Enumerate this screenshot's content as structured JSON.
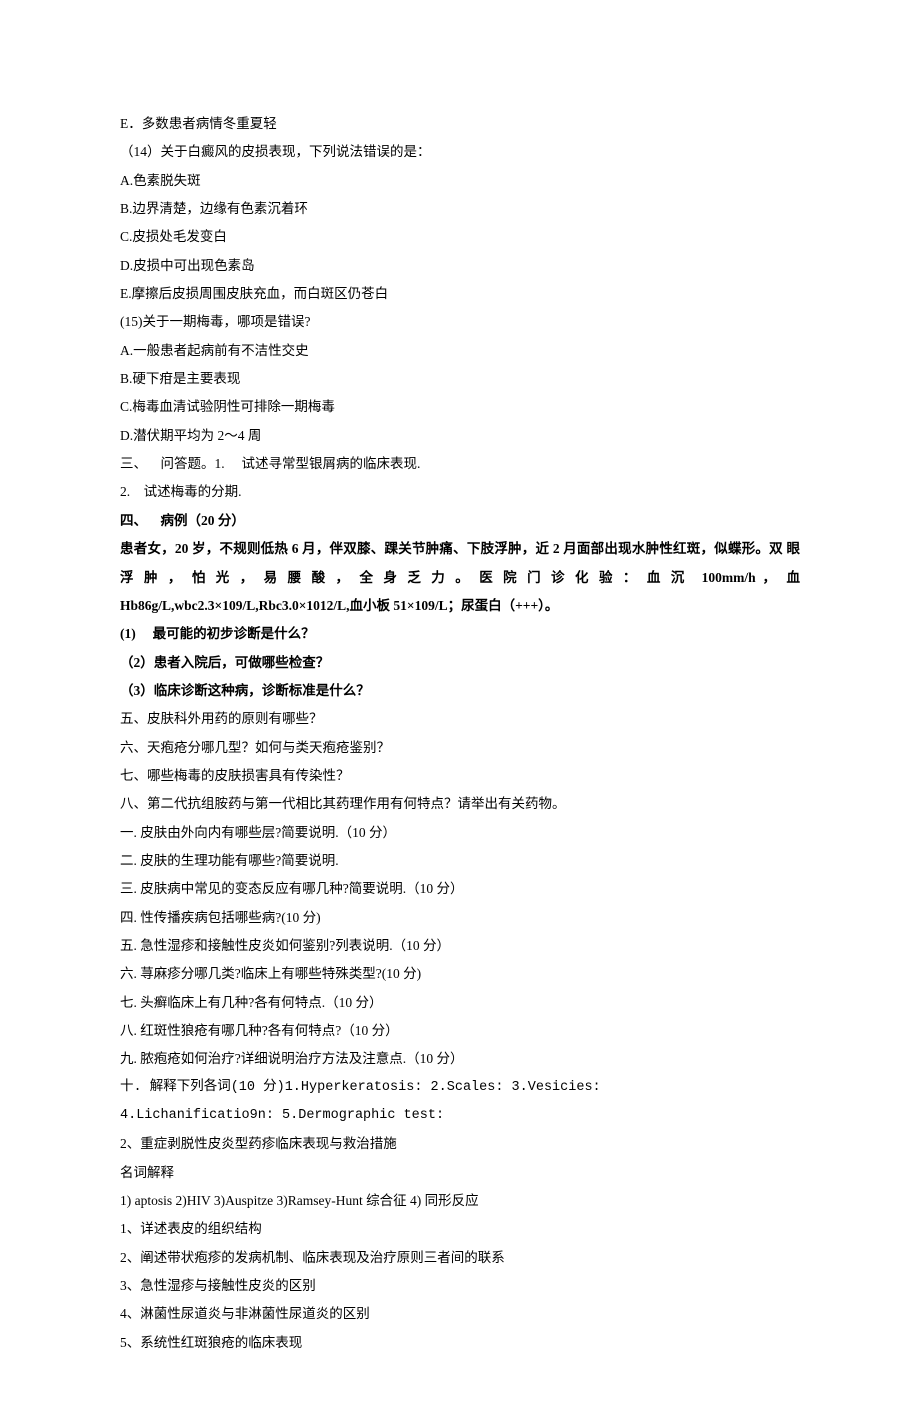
{
  "lines": [
    {
      "text": "E．多数患者病情冬重夏轻",
      "bold": false
    },
    {
      "text": "（14）关于白癜风的皮损表现，下列说法错误的是：",
      "bold": false
    },
    {
      "text": "A.色素脱失斑",
      "bold": false
    },
    {
      "text": "B.边界清楚，边缘有色素沉着环",
      "bold": false
    },
    {
      "text": "C.皮损处毛发变白",
      "bold": false
    },
    {
      "text": "D.皮损中可出现色素岛",
      "bold": false
    },
    {
      "text": "E.摩擦后皮损周围皮肤充血，而白斑区仍苍白",
      "bold": false
    },
    {
      "text": "(15)关于一期梅毒，哪项是错误?",
      "bold": false
    },
    {
      "text": "A.一般患者起病前有不洁性交史",
      "bold": false
    },
    {
      "text": "B.硬下疳是主要表现",
      "bold": false
    },
    {
      "text": "C.梅毒血清试验阴性可排除一期梅毒",
      "bold": false
    },
    {
      "text": "D.潜伏期平均为 2～4 周",
      "bold": false
    },
    {
      "text": "三、    问答题。1.     试述寻常型银屑病的临床表现.",
      "bold": false
    },
    {
      "text": "2.    试述梅毒的分期.",
      "bold": false
    },
    {
      "text": "四、    病例（20 分）",
      "bold": true
    },
    {
      "text": "患者女，20 岁，不规则低热 6 月，伴双膝、踝关节肿痛、下肢浮肿，近 2 月面部出现水肿性红斑，似蝶形。双 眼 浮 肿 ， 怕 光 ， 易 腰 酸 ， 全 身 乏 力 。 医 院 门 诊 化 验 ： 血 沉  100mm/h ， 血Hb86g/L,wbc2.3×109/L,Rbc3.0×1012/L,血小板 51×109/L；尿蛋白（+++）。",
      "bold": true
    },
    {
      "text": "(1)     最可能的初步诊断是什么？",
      "bold": true
    },
    {
      "text": "（2）患者入院后，可做哪些检查？",
      "bold": true
    },
    {
      "text": "（3）临床诊断这种病，诊断标准是什么？",
      "bold": true
    },
    {
      "text": "五、皮肤科外用药的原则有哪些？",
      "bold": false
    },
    {
      "text": "六、天疱疮分哪几型？如何与类天疱疮鉴别？",
      "bold": false
    },
    {
      "text": "七、哪些梅毒的皮肤损害具有传染性？",
      "bold": false
    },
    {
      "text": "八、第二代抗组胺药与第一代相比其药理作用有何特点？请举出有关药物。",
      "bold": false
    },
    {
      "text": "一. 皮肤由外向内有哪些层?简要说明.（10 分）",
      "bold": false
    },
    {
      "text": "二. 皮肤的生理功能有哪些?简要说明.",
      "bold": false
    },
    {
      "text": "三. 皮肤病中常见的变态反应有哪几种?简要说明.（10 分）",
      "bold": false
    },
    {
      "text": "四. 性传播疾病包括哪些病?(10 分)",
      "bold": false
    },
    {
      "text": "五. 急性湿疹和接触性皮炎如何鉴别?列表说明.（10 分）",
      "bold": false
    },
    {
      "text": "六. 荨麻疹分哪几类?临床上有哪些特殊类型?(10 分)",
      "bold": false
    },
    {
      "text": "七. 头癣临床上有几种?各有何特点.（10 分）",
      "bold": false
    },
    {
      "text": "八. 红斑性狼疮有哪几种?各有何特点?（10 分）",
      "bold": false
    },
    {
      "text": "九. 脓疱疮如何治疗?详细说明治疗方法及注意点.（10 分）",
      "bold": false
    },
    {
      "text": "十. 解释下列各词(10 分)1.Hyperkeratosis: 2.Scales: 3.Vesicies:",
      "bold": false
    },
    {
      "text": "4.Lichanificatio9n: 5.Dermographic test:",
      "bold": false
    },
    {
      "text": "2、重症剥脱性皮炎型药疹临床表现与救治措施",
      "bold": false
    },
    {
      "text": "名词解释",
      "bold": false
    },
    {
      "text": "1) aptosis 2)HIV 3)Auspitze 3)Ramsey-Hunt 综合征 4) 同形反应",
      "bold": false
    },
    {
      "text": "1、详述表皮的组织结构",
      "bold": false
    },
    {
      "text": "2、阐述带状疱疹的发病机制、临床表现及治疗原则三者间的联系",
      "bold": false
    },
    {
      "text": "3、急性湿疹与接触性皮炎的区别",
      "bold": false
    },
    {
      "text": "4、淋菌性尿道炎与非淋菌性尿道炎的区别",
      "bold": false
    },
    {
      "text": "5、系统性红斑狼疮的临床表现",
      "bold": false
    }
  ]
}
